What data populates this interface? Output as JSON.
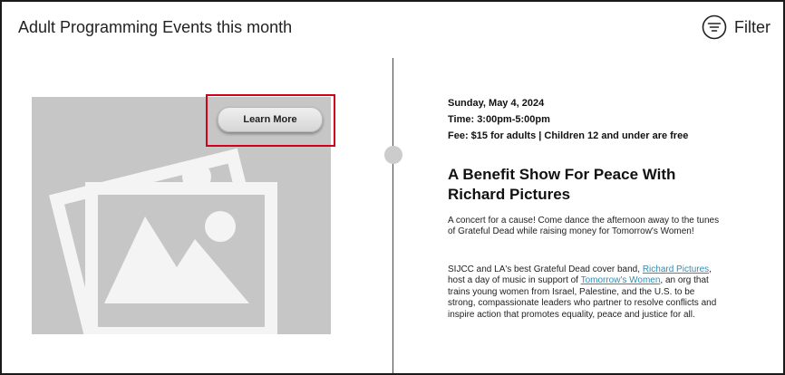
{
  "header": {
    "title": "Adult Programming Events this month",
    "filter_label": "Filter",
    "filter_icon": "filter-icon"
  },
  "card": {
    "image_icon": "image-placeholder-icon",
    "learn_more_label": "Learn More"
  },
  "event": {
    "date": "Sunday, May 4, 2024",
    "time": "Time: 3:00pm-5:00pm",
    "fee": "Fee: $15 for adults | Children 12 and under are free",
    "title": "A Benefit Show For Peace With Richard Pictures",
    "description_1": "A concert for a cause! Come dance the afternoon away to the tunes of Grateful Dead while raising money for Tomorrow's Women!",
    "description_2": {
      "part_1": "SIJCC and LA's best Grateful Dead cover band, ",
      "link_1": "Richard Pictures",
      "part_2": ", host a day of music in support of ",
      "link_2": "Tomorrow's Women",
      "part_3": ", an org that trains young women from Israel, Palestine, and the U.S. to be strong, compassionate leaders who partner to resolve conflicts and inspire action that promotes equality, peace and justice for all."
    }
  },
  "colors": {
    "highlight": "#d0021b",
    "link": "#2a8fb8",
    "placeholder_bg": "#c6c6c6"
  }
}
